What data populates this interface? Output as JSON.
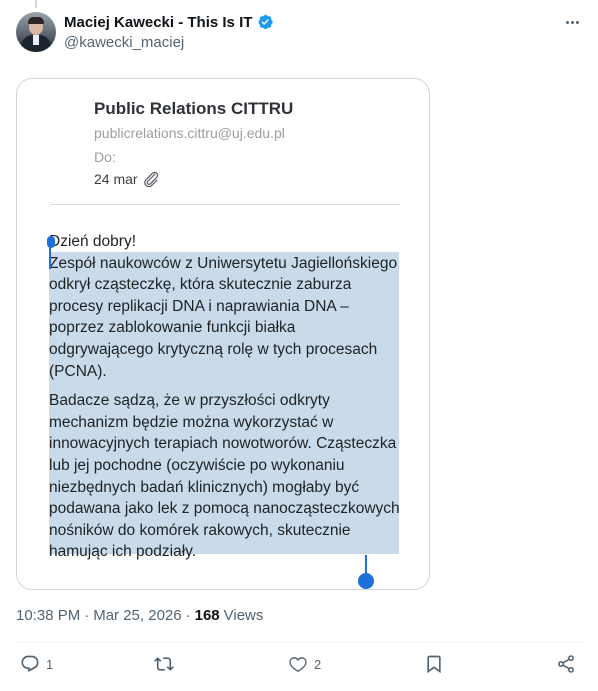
{
  "author": {
    "display_name": "Maciej Kawecki - This Is IT",
    "handle": "@kawecki_maciej",
    "verified": true
  },
  "email": {
    "sender_name": "Public Relations CITTRU",
    "sender_email": "publicrelations.cittru@uj.edu.pl",
    "to_label": "Do:",
    "date": "24 mar",
    "greeting": "Dzień dobry!",
    "paragraph_1": "Zespół naukowców z Uniwersytetu Jagiellońskiego odkrył cząsteczkę, która skutecznie zaburza procesy replikacji DNA i naprawiania DNA – poprzez zablokowanie funkcji białka odgrywającego krytyczną rolę w tych procesach (PCNA).",
    "paragraph_2": "Badacze sądzą, że w przyszłości odkryty mechanizm będzie można wykorzystać w innowacyjnych terapiach nowotworów. Cząsteczka lub jej pochodne (oczywiście po wykonaniu niezbędnych badań klinicznych) mogłaby być podawana jako lek z pomocą nanocząsteczkowych nośników do komórek rakowych, skutecznie hamując ich podziały."
  },
  "meta": {
    "time": "10:38 PM",
    "separator": "·",
    "date": "Mar 25, 2026",
    "views_count": "168",
    "views_label": "Views"
  },
  "actions": {
    "reply_count": "1",
    "retweet_count": "",
    "like_count": "2"
  },
  "colors": {
    "accent": "#1d9bf0",
    "selection": "#c9dbeb",
    "handles": "#1e6fd9",
    "muted_text": "#536471"
  },
  "icons": [
    "verified-badge-icon",
    "more-icon",
    "paperclip-icon",
    "reply-icon",
    "retweet-icon",
    "like-icon",
    "bookmark-icon",
    "share-icon"
  ]
}
